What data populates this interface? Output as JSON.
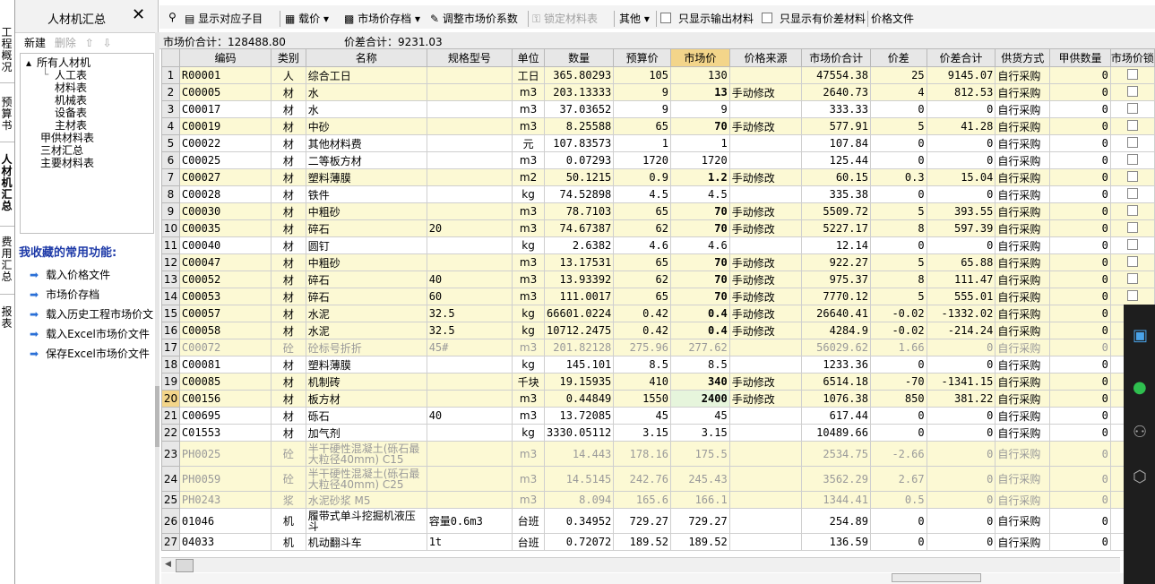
{
  "left_tabs": [
    "工程概况",
    "预算书",
    "人材机汇总",
    "费用汇总",
    "报表"
  ],
  "panel": {
    "title": "人材机汇总",
    "close": "✕",
    "new_label": "新建",
    "delete_label": "删除",
    "up": "⇧",
    "down": "⇩",
    "tree": {
      "root": "所有人材机",
      "children": [
        "人工表",
        "材料表",
        "机械表",
        "设备表",
        "主材表"
      ],
      "others": [
        "甲供材料表",
        "三材汇总",
        "主要材料表"
      ]
    },
    "favorites_title": "我收藏的常用功能:",
    "favorites": [
      "载入价格文件",
      "市场价存档",
      "载入历史工程市场价文",
      "载入Excel市场价文件",
      "保存Excel市场价文件"
    ]
  },
  "toolbar": {
    "show_sub": "显示对应子目",
    "price": "载价",
    "archive": "市场价存档",
    "adjust": "调整市场价系数",
    "lock": "锁定材料表",
    "other": "其他",
    "only_output": "只显示输出材料",
    "only_diff": "只显示有价差材料",
    "price_file": "价格文件"
  },
  "totals": {
    "market_label": "市场价合计：128488.80",
    "diff_label": "价差合计：9231.03"
  },
  "columns": [
    "",
    "编码",
    "类别",
    "名称",
    "规格型号",
    "单位",
    "数量",
    "预算价",
    "市场价",
    "价格来源",
    "市场价合计",
    "价差",
    "价差合计",
    "供货方式",
    "甲供数量",
    "市场价锁"
  ],
  "rows": [
    {
      "n": "1",
      "code": "R00001",
      "cat": "人",
      "name": "综合工日",
      "spec": "",
      "unit": "工日",
      "qty": "365.80293",
      "bp": "105",
      "mp": "130",
      "src": "",
      "mt": "47554.38",
      "d": "25",
      "dt": "9145.07",
      "sup": "自行采购",
      "jg": "0"
    },
    {
      "n": "2",
      "code": "C00005",
      "cat": "材",
      "name": "水",
      "spec": "",
      "unit": "m3",
      "qty": "203.13333",
      "bp": "9",
      "mp": "13",
      "src": "手动修改",
      "mt": "2640.73",
      "d": "4",
      "dt": "812.53",
      "sup": "自行采购",
      "jg": "0"
    },
    {
      "n": "3",
      "code": "C00017",
      "cat": "材",
      "name": "水",
      "spec": "",
      "unit": "m3",
      "qty": "37.03652",
      "bp": "9",
      "mp": "9",
      "src": "",
      "mt": "333.33",
      "d": "0",
      "dt": "0",
      "sup": "自行采购",
      "jg": "0"
    },
    {
      "n": "4",
      "code": "C00019",
      "cat": "材",
      "name": "中砂",
      "spec": "",
      "unit": "m3",
      "qty": "8.25588",
      "bp": "65",
      "mp": "70",
      "src": "手动修改",
      "mt": "577.91",
      "d": "5",
      "dt": "41.28",
      "sup": "自行采购",
      "jg": "0"
    },
    {
      "n": "5",
      "code": "C00022",
      "cat": "材",
      "name": "其他材料费",
      "spec": "",
      "unit": "元",
      "qty": "107.83573",
      "bp": "1",
      "mp": "1",
      "src": "",
      "mt": "107.84",
      "d": "0",
      "dt": "0",
      "sup": "自行采购",
      "jg": "0"
    },
    {
      "n": "6",
      "code": "C00025",
      "cat": "材",
      "name": "二等板方材",
      "spec": "",
      "unit": "m3",
      "qty": "0.07293",
      "bp": "1720",
      "mp": "1720",
      "src": "",
      "mt": "125.44",
      "d": "0",
      "dt": "0",
      "sup": "自行采购",
      "jg": "0"
    },
    {
      "n": "7",
      "code": "C00027",
      "cat": "材",
      "name": "塑料薄膜",
      "spec": "",
      "unit": "m2",
      "qty": "50.1215",
      "bp": "0.9",
      "mp": "1.2",
      "src": "手动修改",
      "mt": "60.15",
      "d": "0.3",
      "dt": "15.04",
      "sup": "自行采购",
      "jg": "0"
    },
    {
      "n": "8",
      "code": "C00028",
      "cat": "材",
      "name": "铁件",
      "spec": "",
      "unit": "kg",
      "qty": "74.52898",
      "bp": "4.5",
      "mp": "4.5",
      "src": "",
      "mt": "335.38",
      "d": "0",
      "dt": "0",
      "sup": "自行采购",
      "jg": "0"
    },
    {
      "n": "9",
      "code": "C00030",
      "cat": "材",
      "name": "中粗砂",
      "spec": "",
      "unit": "m3",
      "qty": "78.7103",
      "bp": "65",
      "mp": "70",
      "src": "手动修改",
      "mt": "5509.72",
      "d": "5",
      "dt": "393.55",
      "sup": "自行采购",
      "jg": "0"
    },
    {
      "n": "10",
      "code": "C00035",
      "cat": "材",
      "name": "碎石",
      "spec": "20",
      "unit": "m3",
      "qty": "74.67387",
      "bp": "62",
      "mp": "70",
      "src": "手动修改",
      "mt": "5227.17",
      "d": "8",
      "dt": "597.39",
      "sup": "自行采购",
      "jg": "0"
    },
    {
      "n": "11",
      "code": "C00040",
      "cat": "材",
      "name": "圆钉",
      "spec": "",
      "unit": "kg",
      "qty": "2.6382",
      "bp": "4.6",
      "mp": "4.6",
      "src": "",
      "mt": "12.14",
      "d": "0",
      "dt": "0",
      "sup": "自行采购",
      "jg": "0"
    },
    {
      "n": "12",
      "code": "C00047",
      "cat": "材",
      "name": "中粗砂",
      "spec": "",
      "unit": "m3",
      "qty": "13.17531",
      "bp": "65",
      "mp": "70",
      "src": "手动修改",
      "mt": "922.27",
      "d": "5",
      "dt": "65.88",
      "sup": "自行采购",
      "jg": "0"
    },
    {
      "n": "13",
      "code": "C00052",
      "cat": "材",
      "name": "碎石",
      "spec": "40",
      "unit": "m3",
      "qty": "13.93392",
      "bp": "62",
      "mp": "70",
      "src": "手动修改",
      "mt": "975.37",
      "d": "8",
      "dt": "111.47",
      "sup": "自行采购",
      "jg": "0"
    },
    {
      "n": "14",
      "code": "C00053",
      "cat": "材",
      "name": "碎石",
      "spec": "60",
      "unit": "m3",
      "qty": "111.0017",
      "bp": "65",
      "mp": "70",
      "src": "手动修改",
      "mt": "7770.12",
      "d": "5",
      "dt": "555.01",
      "sup": "自行采购",
      "jg": "0"
    },
    {
      "n": "15",
      "code": "C00057",
      "cat": "材",
      "name": "水泥",
      "spec": "32.5",
      "unit": "kg",
      "qty": "66601.0224",
      "bp": "0.42",
      "mp": "0.4",
      "src": "手动修改",
      "mt": "26640.41",
      "d": "-0.02",
      "dt": "-1332.02",
      "sup": "自行采购",
      "jg": "0"
    },
    {
      "n": "16",
      "code": "C00058",
      "cat": "材",
      "name": "水泥",
      "spec": "32.5",
      "unit": "kg",
      "qty": "10712.2475",
      "bp": "0.42",
      "mp": "0.4",
      "src": "手动修改",
      "mt": "4284.9",
      "d": "-0.02",
      "dt": "-214.24",
      "sup": "自行采购",
      "jg": "0"
    },
    {
      "n": "17",
      "code": "C00072",
      "cat": "砼",
      "name": "砼标号折折",
      "spec": "45#",
      "unit": "m3",
      "qty": "201.82128",
      "bp": "275.96",
      "mp": "277.62",
      "src": "",
      "mt": "56029.62",
      "d": "1.66",
      "dt": "0",
      "sup": "自行采购",
      "jg": "0"
    },
    {
      "n": "18",
      "code": "C00081",
      "cat": "材",
      "name": "塑料薄膜",
      "spec": "",
      "unit": "kg",
      "qty": "145.101",
      "bp": "8.5",
      "mp": "8.5",
      "src": "",
      "mt": "1233.36",
      "d": "0",
      "dt": "0",
      "sup": "自行采购",
      "jg": "0"
    },
    {
      "n": "19",
      "code": "C00085",
      "cat": "材",
      "name": "机制砖",
      "spec": "",
      "unit": "千块",
      "qty": "19.15935",
      "bp": "410",
      "mp": "340",
      "src": "手动修改",
      "mt": "6514.18",
      "d": "-70",
      "dt": "-1341.15",
      "sup": "自行采购",
      "jg": "0"
    },
    {
      "n": "20",
      "code": "C00156",
      "cat": "材",
      "name": "板方材",
      "spec": "",
      "unit": "m3",
      "qty": "0.44849",
      "bp": "1550",
      "mp": "2400",
      "src": "手动修改",
      "mt": "1076.38",
      "d": "850",
      "dt": "381.22",
      "sup": "自行采购",
      "jg": "0"
    },
    {
      "n": "21",
      "code": "C00695",
      "cat": "材",
      "name": "砾石",
      "spec": "40",
      "unit": "m3",
      "qty": "13.72085",
      "bp": "45",
      "mp": "45",
      "src": "",
      "mt": "617.44",
      "d": "0",
      "dt": "0",
      "sup": "自行采购",
      "jg": "0"
    },
    {
      "n": "22",
      "code": "C01553",
      "cat": "材",
      "name": "加气剂",
      "spec": "",
      "unit": "kg",
      "qty": "3330.05112",
      "bp": "3.15",
      "mp": "3.15",
      "src": "",
      "mt": "10489.66",
      "d": "0",
      "dt": "0",
      "sup": "自行采购",
      "jg": "0"
    },
    {
      "n": "23",
      "code": "PH0025",
      "cat": "砼",
      "name": "半干硬性混凝土(砾石最大粒径40mm) C15",
      "spec": "",
      "unit": "m3",
      "qty": "14.443",
      "bp": "178.16",
      "mp": "175.5",
      "src": "",
      "mt": "2534.75",
      "d": "-2.66",
      "dt": "0",
      "sup": "自行采购",
      "jg": "0"
    },
    {
      "n": "24",
      "code": "PH0059",
      "cat": "砼",
      "name": "半干硬性混凝土(砾石最大粒径40mm) C25",
      "spec": "",
      "unit": "m3",
      "qty": "14.5145",
      "bp": "242.76",
      "mp": "245.43",
      "src": "",
      "mt": "3562.29",
      "d": "2.67",
      "dt": "0",
      "sup": "自行采购",
      "jg": "0"
    },
    {
      "n": "25",
      "code": "PH0243",
      "cat": "浆",
      "name": "水泥砂浆 M5",
      "spec": "",
      "unit": "m3",
      "qty": "8.094",
      "bp": "165.6",
      "mp": "166.1",
      "src": "",
      "mt": "1344.41",
      "d": "0.5",
      "dt": "0",
      "sup": "自行采购",
      "jg": "0"
    },
    {
      "n": "26",
      "code": "01046",
      "cat": "机",
      "name": "履带式单斗挖掘机液压斗",
      "spec": "容量0.6m3",
      "unit": "台班",
      "qty": "0.34952",
      "bp": "729.27",
      "mp": "729.27",
      "src": "",
      "mt": "254.89",
      "d": "0",
      "dt": "0",
      "sup": "自行采购",
      "jg": "0"
    },
    {
      "n": "27",
      "code": "04033",
      "cat": "机",
      "name": "机动翻斗车",
      "spec": "1t",
      "unit": "台班",
      "qty": "0.72072",
      "bp": "189.52",
      "mp": "189.52",
      "src": "",
      "mt": "136.59",
      "d": "0",
      "dt": "0",
      "sup": "自行采购",
      "jg": "0"
    }
  ]
}
